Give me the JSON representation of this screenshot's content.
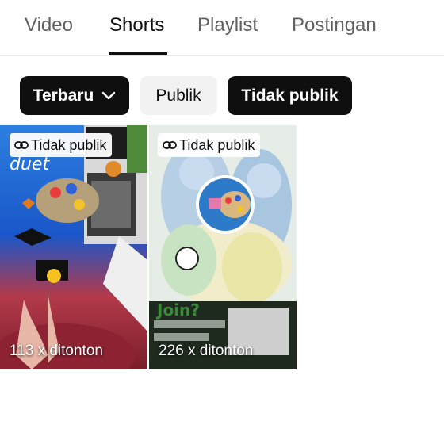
{
  "tabs": [
    {
      "label": "Video",
      "active": false
    },
    {
      "label": "Shorts",
      "active": true
    },
    {
      "label": "Playlist",
      "active": false
    },
    {
      "label": "Postingan",
      "active": false
    }
  ],
  "filters": {
    "sort_label": "Terbaru",
    "public_label": "Publik",
    "private_label": "Tidak publik"
  },
  "shorts": [
    {
      "visibility": "Tidak publik",
      "views": "113 x ditonton",
      "overlay_text": "duet"
    },
    {
      "visibility": "Tidak publik",
      "views": "226 x ditonton",
      "overlay_text": "Join?"
    }
  ],
  "colors": {
    "active_text": "#0f0f0f",
    "inactive_text": "#606060",
    "chip_dark": "#0f0f0f",
    "chip_light": "#f2f2f2"
  },
  "icons": {
    "sort_chip": "chevron-down-icon",
    "visibility": "link-icon"
  }
}
